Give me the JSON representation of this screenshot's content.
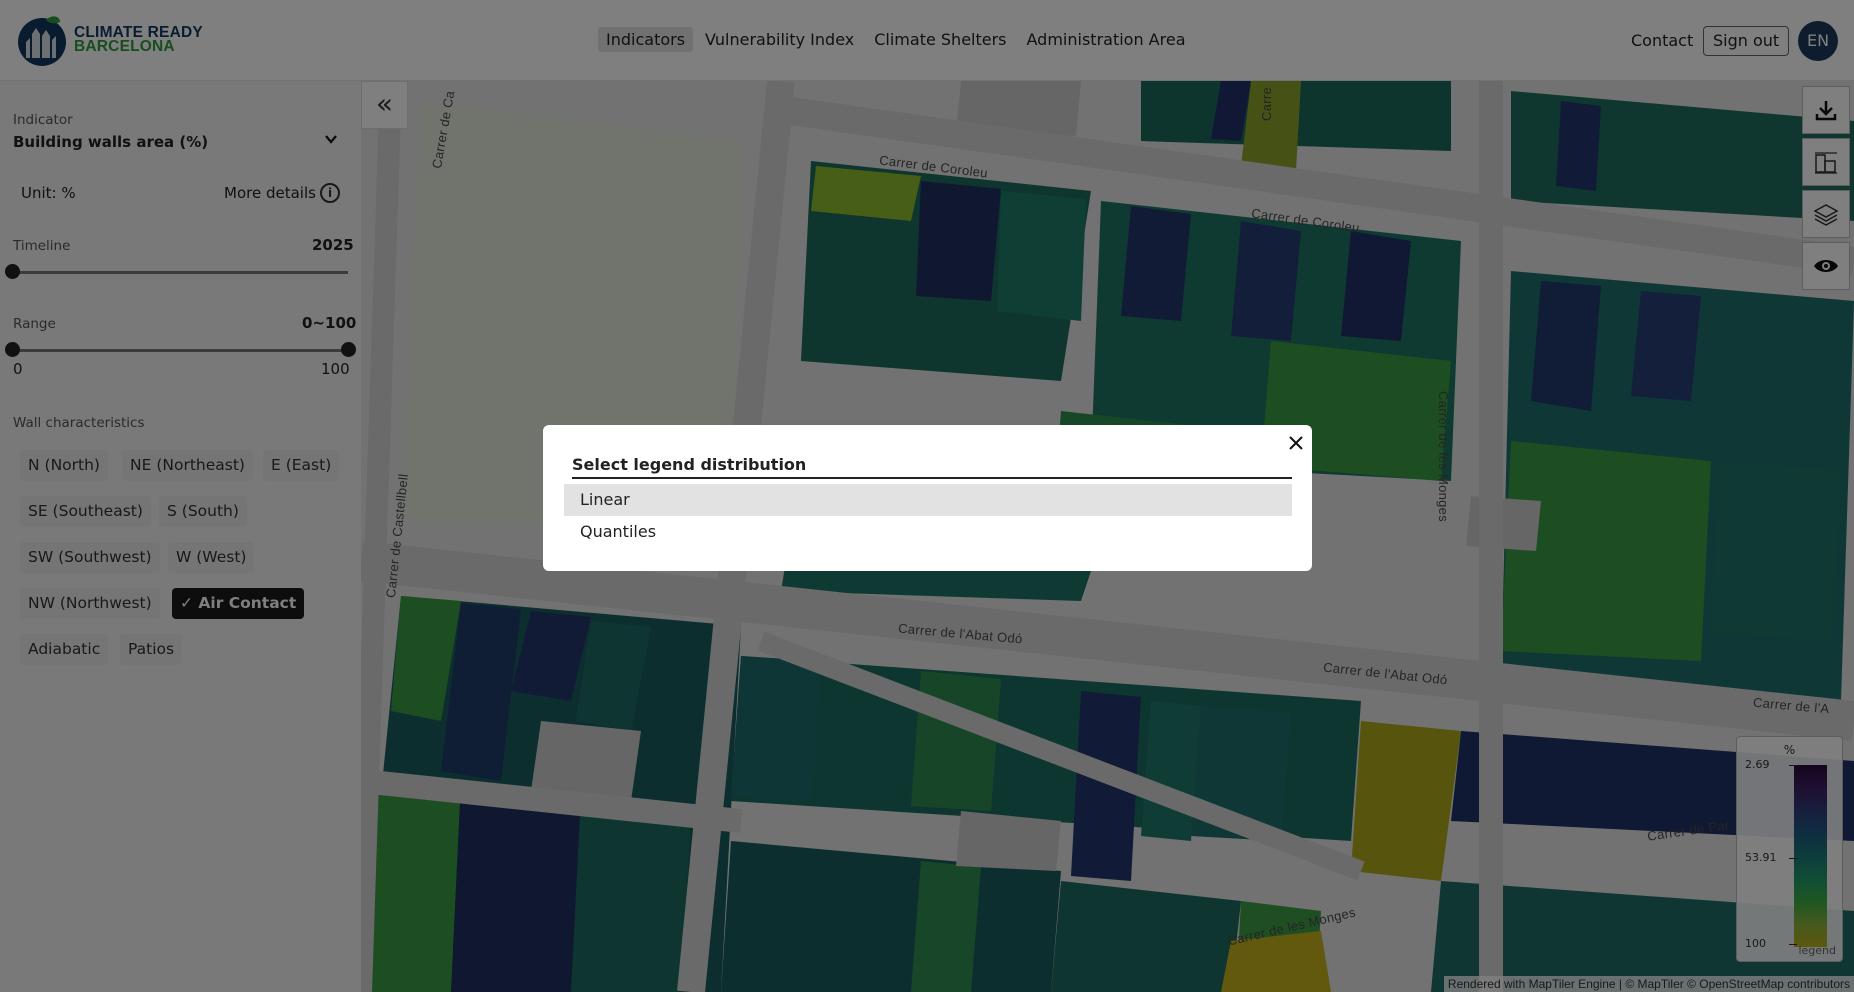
{
  "header": {
    "logo": {
      "line1": "CLIMATE READY",
      "line2": "BARCELONA"
    },
    "nav": [
      {
        "label": "Indicators",
        "active": true
      },
      {
        "label": "Vulnerability Index",
        "active": false
      },
      {
        "label": "Climate Shelters",
        "active": false
      },
      {
        "label": "Administration Area",
        "active": false
      }
    ],
    "contact": "Contact",
    "sign_out": "Sign out",
    "language": "EN"
  },
  "sidebar": {
    "indicator_label": "Indicator",
    "indicator_value": "Building walls area (%)",
    "unit": "Unit: %",
    "more_details": "More details",
    "timeline_label": "Timeline",
    "timeline_value": "2025",
    "timeline_level": 0,
    "range_label": "Range",
    "range_value": "0~100",
    "range_min": "0",
    "range_max": "100",
    "wall_label": "Wall characteristics",
    "tags": [
      {
        "label": "N (North)",
        "selected": false
      },
      {
        "label": "NE (Northeast)",
        "selected": false
      },
      {
        "label": "E (East)",
        "selected": false
      },
      {
        "label": "SE (Southeast)",
        "selected": false
      },
      {
        "label": "S (South)",
        "selected": false
      },
      {
        "label": "SW (Southwest)",
        "selected": false
      },
      {
        "label": "W (West)",
        "selected": false
      },
      {
        "label": "NW (Northwest)",
        "selected": false
      },
      {
        "label": "✓ Air Contact",
        "selected": true
      },
      {
        "label": "Adiabatic",
        "selected": false
      },
      {
        "label": "Patios",
        "selected": false
      }
    ]
  },
  "map": {
    "streets": [
      "Carrer de Coroleu",
      "Carrer de Coroleu",
      "Carrer de l'Abat Odó",
      "Carrer de l'Abat Odó",
      "Carrer de l'A",
      "Carrer de les Monges",
      "Carrer de les Monges",
      "Carrer de Castellbell",
      "Carrer de Ca",
      "Carrer de Par",
      "Carre"
    ],
    "legend": {
      "unit": "%",
      "ticks": [
        "2.69",
        "53.91",
        "100"
      ],
      "footer": "legend"
    },
    "attribution": "Rendered with MapTiler Engine | © MapTiler © OpenStreetMap contributors",
    "tools": [
      "download-icon",
      "building-chart-icon",
      "layers-icon",
      "eye-icon"
    ]
  },
  "modal": {
    "title": "Select legend distribution",
    "options": [
      {
        "label": "Linear",
        "highlighted": true
      },
      {
        "label": "Quantiles",
        "highlighted": false
      }
    ]
  },
  "colors": {
    "brand_navy": "#12395f",
    "brand_green": "#2e9c3c",
    "selected_tag": "#1a1a1a"
  }
}
